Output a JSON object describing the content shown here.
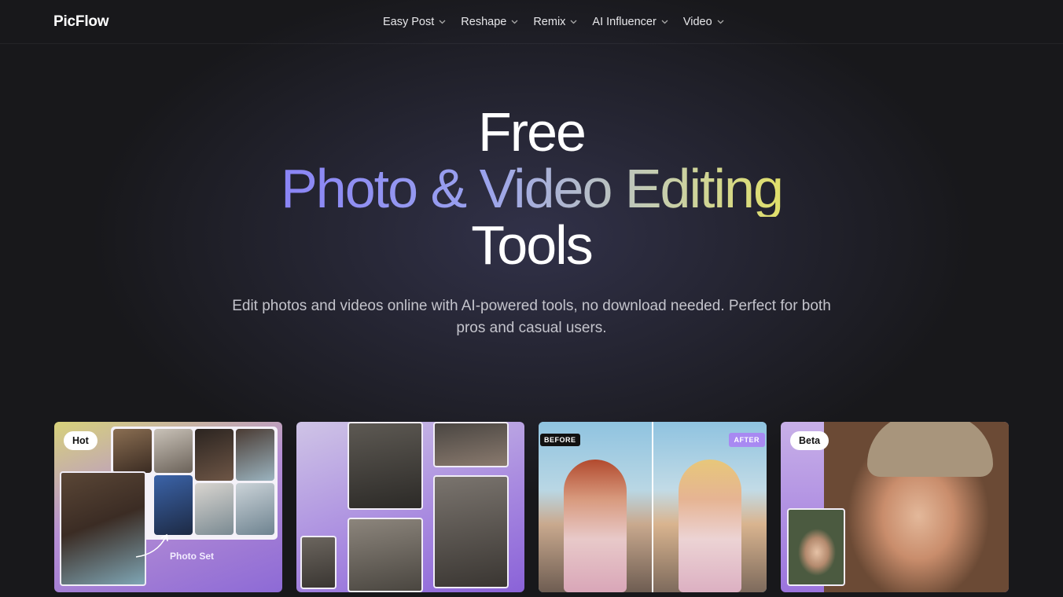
{
  "brand": {
    "logo": "PicFlow"
  },
  "nav": {
    "items": [
      {
        "label": "Easy Post"
      },
      {
        "label": "Reshape"
      },
      {
        "label": "Remix"
      },
      {
        "label": "AI Influencer"
      },
      {
        "label": "Video"
      }
    ]
  },
  "hero": {
    "line1": "Free",
    "line2": "Photo & Video Editing",
    "line3": "Tools",
    "subtitle": "Edit photos and videos online with AI-powered tools, no download needed. Perfect for both pros and casual users."
  },
  "cards": [
    {
      "badge": "Hot",
      "caption": "Photo Set"
    },
    {},
    {
      "before": "BEFORE",
      "after": "AFTER"
    },
    {
      "badge": "Beta"
    }
  ],
  "colors": {
    "background": "#18181b",
    "gradient_start": "#8a84f5",
    "gradient_end": "#e1e06a",
    "accent_purple": "#a889f2"
  }
}
